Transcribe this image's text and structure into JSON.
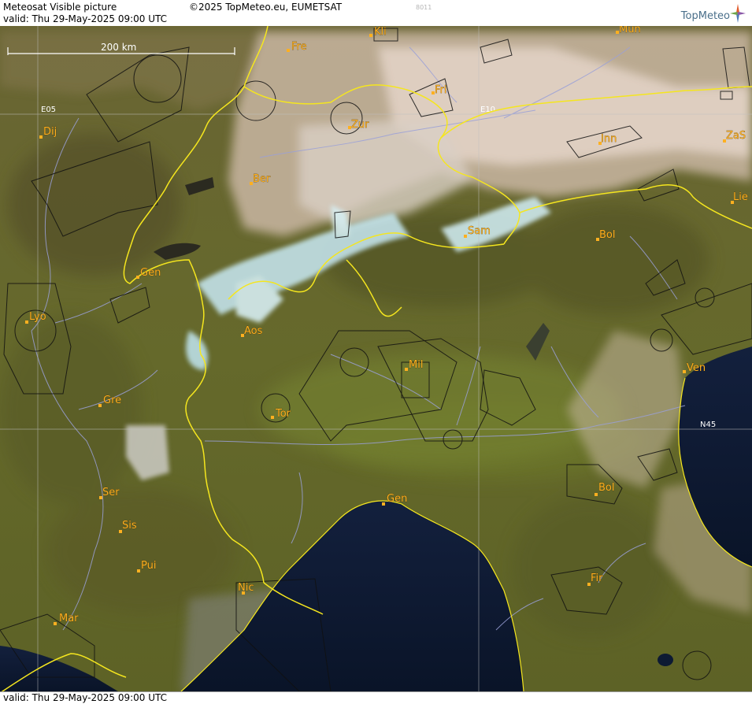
{
  "header": {
    "title": "Meteosat Visible picture",
    "copyright": "©2025 TopMeteo.eu, EUMETSAT",
    "valid_line": "valid:  Thu   29-May-2025   09:00 UTC",
    "image_code": "8011",
    "brand": "TopMeteo",
    "brand_icon": "compass-star-icon"
  },
  "footer": {
    "valid_line": "valid:  Thu   29-May-2025   09:00 UTC"
  },
  "map": {
    "scale_bar_label": "200 km",
    "grid_labels": {
      "lon_5": "E05",
      "lon_10": "E10",
      "lat_45": "N45"
    },
    "cities": [
      {
        "id": "kli",
        "name": "Kli"
      },
      {
        "id": "mun",
        "name": "Mun"
      },
      {
        "id": "fre",
        "name": "Fre"
      },
      {
        "id": "fri",
        "name": "Fri"
      },
      {
        "id": "dij",
        "name": "Dij"
      },
      {
        "id": "zur",
        "name": "Zur"
      },
      {
        "id": "zas",
        "name": "ZaS"
      },
      {
        "id": "inn",
        "name": "Inn"
      },
      {
        "id": "ber",
        "name": "Ber"
      },
      {
        "id": "lie",
        "name": "Lie"
      },
      {
        "id": "sam",
        "name": "Sam"
      },
      {
        "id": "bol-n",
        "name": "Bol"
      },
      {
        "id": "gen-ch",
        "name": "Gen"
      },
      {
        "id": "lyo",
        "name": "Lyo"
      },
      {
        "id": "aos",
        "name": "Aos"
      },
      {
        "id": "mil",
        "name": "Mil"
      },
      {
        "id": "ven",
        "name": "Ven"
      },
      {
        "id": "gre",
        "name": "Gre"
      },
      {
        "id": "tor",
        "name": "Tor"
      },
      {
        "id": "ser",
        "name": "Ser"
      },
      {
        "id": "gen-it",
        "name": "Gen"
      },
      {
        "id": "bol-s",
        "name": "Bol"
      },
      {
        "id": "sis",
        "name": "Sis"
      },
      {
        "id": "pui",
        "name": "Pui"
      },
      {
        "id": "nic",
        "name": "Nic"
      },
      {
        "id": "fir",
        "name": "Fir"
      },
      {
        "id": "mar",
        "name": "Mar"
      }
    ],
    "colors": {
      "land": "#6b6a2c",
      "land_dark": "#4c4a22",
      "sea": "#0d1a33",
      "cloud": "#d8cbb8",
      "snow": "#c8e6ee",
      "border": "#f5e61e",
      "river": "#9aa0d8",
      "grid": "#bfbfbf",
      "city": "#ffb020"
    }
  }
}
